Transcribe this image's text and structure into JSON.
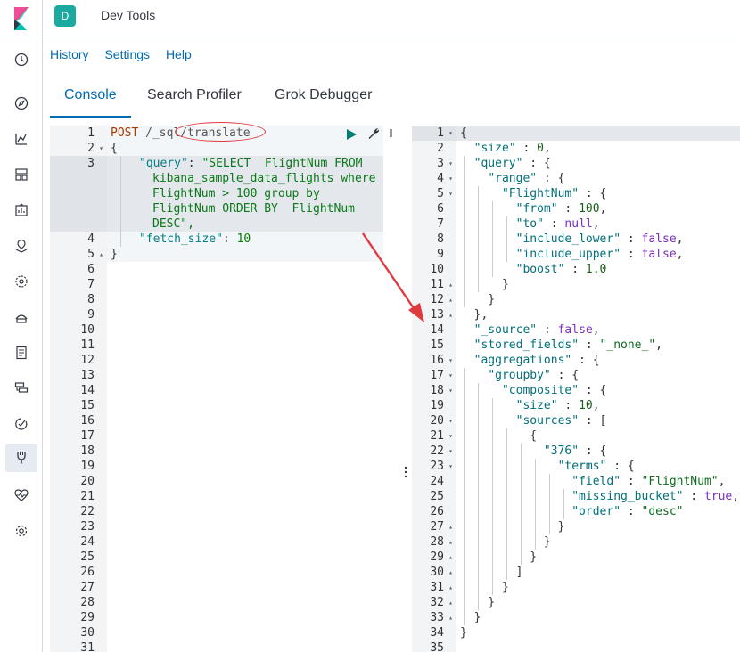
{
  "header": {
    "space_initial": "D",
    "app_title": "Dev Tools"
  },
  "menu": {
    "history": "History",
    "settings": "Settings",
    "help": "Help"
  },
  "tabs": [
    {
      "label": "Console",
      "active": true
    },
    {
      "label": "Search Profiler",
      "active": false
    },
    {
      "label": "Grok Debugger",
      "active": false
    }
  ],
  "nav_icons": [
    "clock-icon",
    "compass-icon",
    "visualize-icon",
    "dashboard-icon",
    "canvas-icon",
    "maps-icon",
    "ml-icon",
    "infrastructure-icon",
    "logs-icon",
    "apm-icon",
    "uptime-icon",
    "devtools-icon",
    "monitoring-icon",
    "management-icon"
  ],
  "request": {
    "line1_method": "POST",
    "line1_url": " /_sql/translate",
    "line2": "{",
    "line3a": "\"query\"",
    "line3b": ": ",
    "line3c": "\"SELECT  FlightNum FROM",
    "line3d": "kibana_sample_data_flights where",
    "line3e": "FlightNum > 100 group by",
    "line3f": "FlightNum ORDER BY  FlightNum",
    "line3g": "DESC\",",
    "line4a": "\"fetch_size\"",
    "line4b": ": ",
    "line4c": "10",
    "line5": "}",
    "line_numbers": [
      "1",
      "2",
      "3",
      "4",
      "5",
      "6",
      "7",
      "8",
      "9",
      "10",
      "11",
      "12",
      "13",
      "14",
      "15",
      "16",
      "17",
      "18",
      "19",
      "20",
      "21",
      "22",
      "23",
      "24",
      "25",
      "26",
      "27",
      "28",
      "29",
      "30",
      "31"
    ]
  },
  "response": {
    "line_numbers": [
      "1",
      "2",
      "3",
      "4",
      "5",
      "6",
      "7",
      "8",
      "9",
      "10",
      "11",
      "12",
      "13",
      "14",
      "15",
      "16",
      "17",
      "18",
      "19",
      "20",
      "21",
      "22",
      "23",
      "24",
      "25",
      "26",
      "27",
      "28",
      "29",
      "30",
      "31",
      "32",
      "33",
      "34",
      "35"
    ],
    "lines": [
      "{",
      "  \"size\" : 0,",
      "  \"query\" : {",
      "    \"range\" : {",
      "      \"FlightNum\" : {",
      "        \"from\" : 100,",
      "        \"to\" : null,",
      "        \"include_lower\" : false,",
      "        \"include_upper\" : false,",
      "        \"boost\" : 1.0",
      "      }",
      "    }",
      "  },",
      "  \"_source\" : false,",
      "  \"stored_fields\" : \"_none_\",",
      "  \"aggregations\" : {",
      "    \"groupby\" : {",
      "      \"composite\" : {",
      "        \"size\" : 10,",
      "        \"sources\" : [",
      "          {",
      "            \"376\" : {",
      "              \"terms\" : {",
      "                \"field\" : \"FlightNum\",",
      "                \"missing_bucket\" : true,",
      "                \"order\" : \"desc\"",
      "              }",
      "            }",
      "          }",
      "        ]",
      "      }",
      "    }",
      "  }",
      "}",
      ""
    ]
  },
  "colors": {
    "accent": "#006bb4",
    "annotation": "#e0393e",
    "badge": "#1ba9a0"
  }
}
